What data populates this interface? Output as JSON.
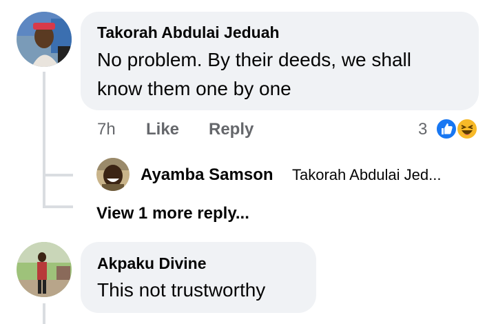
{
  "comments": [
    {
      "author": "Takorah Abdulai Jeduah",
      "text_line1": "No problem. By their deeds, we shall",
      "text_line2": "know them one by one",
      "time": "7h",
      "like_label": "Like",
      "reply_label": "Reply",
      "reaction_count": "3",
      "reactions": [
        "like-icon",
        "haha-icon"
      ],
      "reply_preview": {
        "author": "Ayamba Samson",
        "snippet": "Takorah Abdulai Jed..."
      },
      "view_more_label": "View 1 more reply..."
    },
    {
      "author": "Akpaku Divine",
      "text": "This not trustworthy"
    }
  ],
  "colors": {
    "bubble": "#f0f2f5",
    "meta_text": "#65676b",
    "like_blue": "#1877f2",
    "haha_yellow": "#f7b928",
    "thread_line": "#dadde1"
  }
}
